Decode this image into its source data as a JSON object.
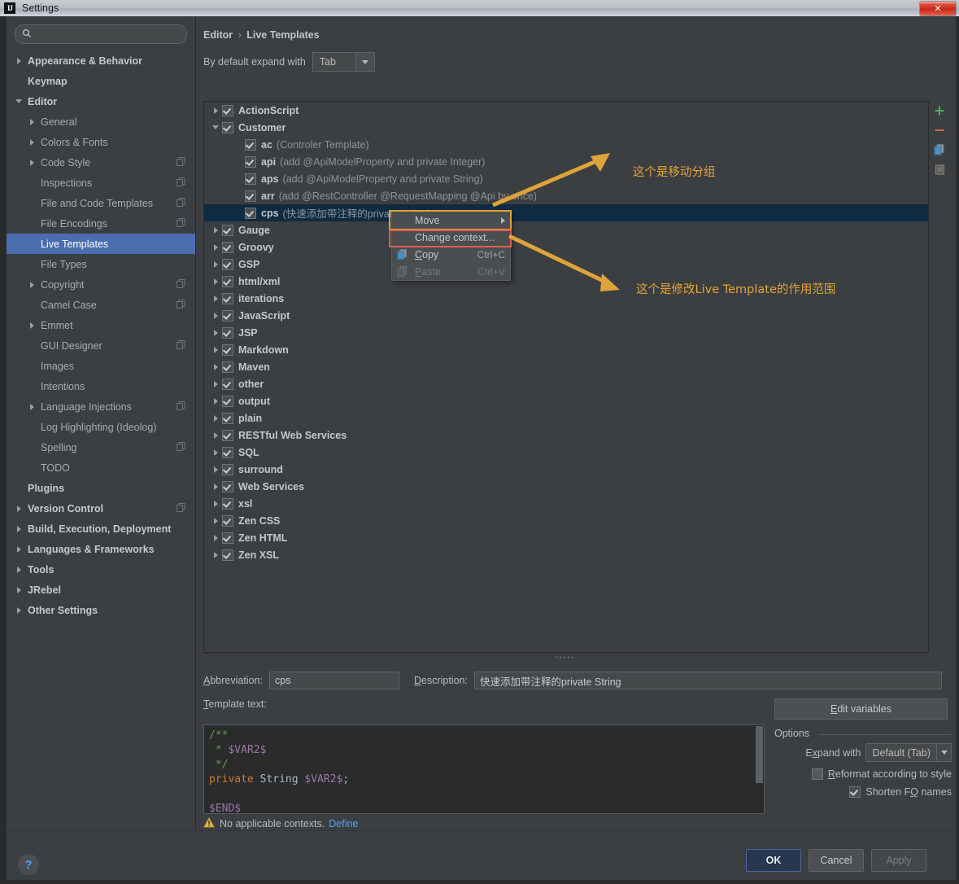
{
  "window": {
    "title": "Settings",
    "logo_text": "IJ",
    "close_label": "✕"
  },
  "sidebar": {
    "search": {
      "value": "",
      "placeholder": ""
    },
    "items": [
      {
        "label": "Appearance & Behavior",
        "level": 0,
        "arrow": "right",
        "bold": true,
        "badge": false
      },
      {
        "label": "Keymap",
        "level": 0,
        "arrow": "none",
        "bold": true,
        "badge": false
      },
      {
        "label": "Editor",
        "level": 0,
        "arrow": "down",
        "bold": true,
        "badge": false
      },
      {
        "label": "General",
        "level": 1,
        "arrow": "right",
        "bold": false,
        "badge": false
      },
      {
        "label": "Colors & Fonts",
        "level": 1,
        "arrow": "right",
        "bold": false,
        "badge": false
      },
      {
        "label": "Code Style",
        "level": 1,
        "arrow": "right",
        "bold": false,
        "badge": true
      },
      {
        "label": "Inspections",
        "level": 1,
        "arrow": "none",
        "bold": false,
        "badge": true
      },
      {
        "label": "File and Code Templates",
        "level": 1,
        "arrow": "none",
        "bold": false,
        "badge": true
      },
      {
        "label": "File Encodings",
        "level": 1,
        "arrow": "none",
        "bold": false,
        "badge": true
      },
      {
        "label": "Live Templates",
        "level": 1,
        "arrow": "none",
        "bold": false,
        "badge": false,
        "selected": true
      },
      {
        "label": "File Types",
        "level": 1,
        "arrow": "none",
        "bold": false,
        "badge": false
      },
      {
        "label": "Copyright",
        "level": 1,
        "arrow": "right",
        "bold": false,
        "badge": true
      },
      {
        "label": "Camel Case",
        "level": 1,
        "arrow": "none",
        "bold": false,
        "badge": true
      },
      {
        "label": "Emmet",
        "level": 1,
        "arrow": "right",
        "bold": false,
        "badge": false
      },
      {
        "label": "GUI Designer",
        "level": 1,
        "arrow": "none",
        "bold": false,
        "badge": true
      },
      {
        "label": "Images",
        "level": 1,
        "arrow": "none",
        "bold": false,
        "badge": false
      },
      {
        "label": "Intentions",
        "level": 1,
        "arrow": "none",
        "bold": false,
        "badge": false
      },
      {
        "label": "Language Injections",
        "level": 1,
        "arrow": "right",
        "bold": false,
        "badge": true
      },
      {
        "label": "Log Highlighting (Ideolog)",
        "level": 1,
        "arrow": "none",
        "bold": false,
        "badge": false
      },
      {
        "label": "Spelling",
        "level": 1,
        "arrow": "none",
        "bold": false,
        "badge": true
      },
      {
        "label": "TODO",
        "level": 1,
        "arrow": "none",
        "bold": false,
        "badge": false
      },
      {
        "label": "Plugins",
        "level": 0,
        "arrow": "none",
        "bold": true,
        "badge": false
      },
      {
        "label": "Version Control",
        "level": 0,
        "arrow": "right",
        "bold": true,
        "badge": true
      },
      {
        "label": "Build, Execution, Deployment",
        "level": 0,
        "arrow": "right",
        "bold": true,
        "badge": false
      },
      {
        "label": "Languages & Frameworks",
        "level": 0,
        "arrow": "right",
        "bold": true,
        "badge": false
      },
      {
        "label": "Tools",
        "level": 0,
        "arrow": "right",
        "bold": true,
        "badge": false
      },
      {
        "label": "JRebel",
        "level": 0,
        "arrow": "right",
        "bold": true,
        "badge": false
      },
      {
        "label": "Other Settings",
        "level": 0,
        "arrow": "right",
        "bold": true,
        "badge": false
      }
    ]
  },
  "main": {
    "breadcrumb": {
      "parent": "Editor",
      "separator": "›",
      "current": "Live Templates"
    },
    "expand_with": {
      "label": "By default expand with",
      "value": "Tab"
    },
    "tree": [
      {
        "name": "ActionScript",
        "desc": "",
        "arrow": "right",
        "checked": true,
        "child": false
      },
      {
        "name": "Customer",
        "desc": "",
        "arrow": "down",
        "checked": true,
        "child": false
      },
      {
        "name": "ac",
        "desc": "(Controler Template)",
        "arrow": "none",
        "checked": true,
        "child": true
      },
      {
        "name": "api",
        "desc": "(add @ApiModelProperty and private Integer)",
        "arrow": "none",
        "checked": true,
        "child": true
      },
      {
        "name": "aps",
        "desc": "(add @ApiModelProperty and private String)",
        "arrow": "none",
        "checked": true,
        "child": true
      },
      {
        "name": "arr",
        "desc": "(add @RestController @RequestMapping @Api by once)",
        "arrow": "none",
        "checked": true,
        "child": true
      },
      {
        "name": "cps",
        "desc": "(快速添加带注释的private String)",
        "arrow": "none",
        "checked": true,
        "child": true,
        "selected": true
      },
      {
        "name": "Gauge",
        "desc": "",
        "arrow": "right",
        "checked": true,
        "child": false
      },
      {
        "name": "Groovy",
        "desc": "",
        "arrow": "right",
        "checked": true,
        "child": false
      },
      {
        "name": "GSP",
        "desc": "",
        "arrow": "right",
        "checked": true,
        "child": false
      },
      {
        "name": "html/xml",
        "desc": "",
        "arrow": "right",
        "checked": true,
        "child": false
      },
      {
        "name": "iterations",
        "desc": "",
        "arrow": "right",
        "checked": true,
        "child": false
      },
      {
        "name": "JavaScript",
        "desc": "",
        "arrow": "right",
        "checked": true,
        "child": false
      },
      {
        "name": "JSP",
        "desc": "",
        "arrow": "right",
        "checked": true,
        "child": false
      },
      {
        "name": "Markdown",
        "desc": "",
        "arrow": "right",
        "checked": true,
        "child": false
      },
      {
        "name": "Maven",
        "desc": "",
        "arrow": "right",
        "checked": true,
        "child": false
      },
      {
        "name": "other",
        "desc": "",
        "arrow": "right",
        "checked": true,
        "child": false
      },
      {
        "name": "output",
        "desc": "",
        "arrow": "right",
        "checked": true,
        "child": false
      },
      {
        "name": "plain",
        "desc": "",
        "arrow": "right",
        "checked": true,
        "child": false
      },
      {
        "name": "RESTful Web Services",
        "desc": "",
        "arrow": "right",
        "checked": true,
        "child": false
      },
      {
        "name": "SQL",
        "desc": "",
        "arrow": "right",
        "checked": true,
        "child": false
      },
      {
        "name": "surround",
        "desc": "",
        "arrow": "right",
        "checked": true,
        "child": false
      },
      {
        "name": "Web Services",
        "desc": "",
        "arrow": "right",
        "checked": true,
        "child": false
      },
      {
        "name": "xsl",
        "desc": "",
        "arrow": "right",
        "checked": true,
        "child": false
      },
      {
        "name": "Zen CSS",
        "desc": "",
        "arrow": "right",
        "checked": true,
        "child": false
      },
      {
        "name": "Zen HTML",
        "desc": "",
        "arrow": "right",
        "checked": true,
        "child": false
      },
      {
        "name": "Zen XSL",
        "desc": "",
        "arrow": "right",
        "checked": true,
        "child": false
      }
    ],
    "tree_toolbar": [
      {
        "icon": "plus-icon",
        "color": "#5aa85a"
      },
      {
        "icon": "minus-icon",
        "color": "#cc6b5a"
      },
      {
        "icon": "copy-icon",
        "color": "#4a90c2"
      },
      {
        "icon": "duplicate-icon",
        "color": "#8e8a72"
      }
    ]
  },
  "context_menu": {
    "items": [
      {
        "label": "Move",
        "accel": "",
        "submenu": true,
        "disabled": false,
        "icon": ""
      },
      {
        "label": "Change context...",
        "accel": "",
        "submenu": false,
        "disabled": false,
        "icon": ""
      },
      {
        "label": "Copy",
        "accel": "Ctrl+C",
        "submenu": false,
        "disabled": false,
        "icon": "copy-icon"
      },
      {
        "label": "Paste",
        "accel": "Ctrl+V",
        "submenu": false,
        "disabled": true,
        "icon": "paste-icon"
      }
    ],
    "highlight_move_color": "#e0a33a",
    "highlight_change_context_color": "#e35c4b"
  },
  "annotations": [
    {
      "text": "这个是移动分组",
      "color": "#e0a33a"
    },
    {
      "text": "这个是修改Live  Template的作用范围",
      "color": "#e0a33a"
    }
  ],
  "detail": {
    "abbreviation_label": "Abbreviation:",
    "abbreviation_value": "cps",
    "description_label": "Description:",
    "description_value": "快速添加带注释的private String",
    "template_text_label": "Template text:",
    "template_code_line1": "/**",
    "template_code_line2": " *  $VAR2$",
    "template_code_line3": " */",
    "template_code_line4": "private String $VAR2$;",
    "template_code_line5": "",
    "template_code_line6": "$END$",
    "context_warning": "No applicable contexts.",
    "context_define_link": "Define",
    "edit_variables_label": "Edit variables",
    "options_legend": "Options",
    "expand_with_label": "Expand with",
    "expand_with_value": "Default (Tab)",
    "reformat_label": "Reformat according to style",
    "reformat_checked": false,
    "shorten_label": "Shorten FQ names",
    "shorten_checked": true
  },
  "footer": {
    "help_label": "?",
    "ok_label": "OK",
    "cancel_label": "Cancel",
    "apply_label": "Apply"
  }
}
